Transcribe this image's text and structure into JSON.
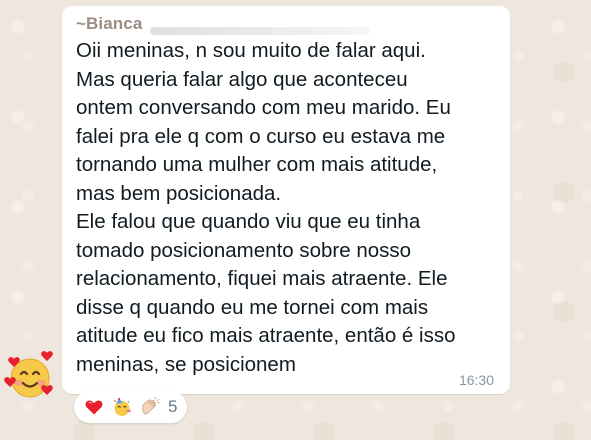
{
  "message": {
    "sender_prefix": "~",
    "sender_name": "Bianca",
    "text": "Oii meninas, n sou muito de falar aqui.\nMas queria falar algo que aconteceu\nontem conversando com meu marido. Eu\nfalei pra ele q com o curso eu estava me\ntornando uma mulher com mais atitude,\nmas bem posicionada.\nEle falou que quando viu que eu tinha\ntomado posicionamento sobre nosso\nrelacionamento, fiquei mais atraente. Ele\ndisse q quando eu me tornei com mais\natitude eu fico mais atraente, então é isso\nmeninas, se posicionem",
    "time": "16:30"
  },
  "sender_avatar_icon": "smiling-face-with-hearts-icon",
  "reactions": {
    "icons": [
      "red-heart-icon",
      "partying-face-icon",
      "clapping-hands-icon"
    ],
    "count": "5"
  },
  "colors": {
    "wallpaper": "#efe7dd",
    "bubble": "#ffffff",
    "sender_name": "#9a8d86",
    "text": "#111b21",
    "timestamp": "#8696a0"
  }
}
